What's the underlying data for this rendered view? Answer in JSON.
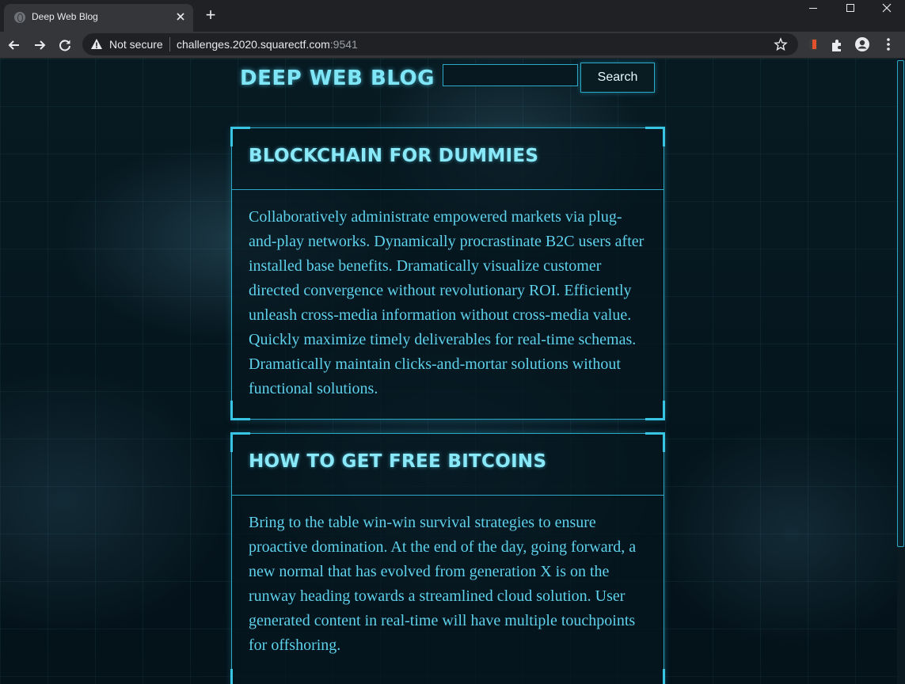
{
  "browser": {
    "tab_title": "Deep Web Blog",
    "new_tab_label": "+",
    "security_label": "Not secure",
    "url_host": "challenges.2020.squarectf.com",
    "url_port": ":9541"
  },
  "site": {
    "title": "DEEP WEB BLOG",
    "search_placeholder": "",
    "search_value": "",
    "search_button_label": "Search"
  },
  "posts": [
    {
      "title": "BLOCKCHAIN FOR DUMMIES",
      "body": "Collaboratively administrate empowered markets via plug-and-play networks. Dynamically procrastinate B2C users after installed base benefits. Dramatically visualize customer directed convergence without revolutionary ROI. Efficiently unleash cross-media information without cross-media value. Quickly maximize timely deliverables for real-time schemas. Dramatically maintain clicks-and-mortar solutions without functional solutions."
    },
    {
      "title": "HOW TO GET FREE BITCOINS",
      "body": "Bring to the table win-win survival strategies to ensure proactive domination. At the end of the day, going forward, a new normal that has evolved from generation X is on the runway heading towards a streamlined cloud solution. User generated content in real-time will have multiple touchpoints for offshoring."
    }
  ],
  "icons": {
    "favicon": "globe-icon",
    "security": "warning-icon",
    "bookmark": "star-icon",
    "extension": "puzzle-icon",
    "profile": "account-icon",
    "menu": "kebab-menu-icon"
  },
  "colors": {
    "accent": "#2aaac8",
    "heading": "#8ae9f8",
    "body_text": "#5ed2ec",
    "background": "#05141c"
  }
}
